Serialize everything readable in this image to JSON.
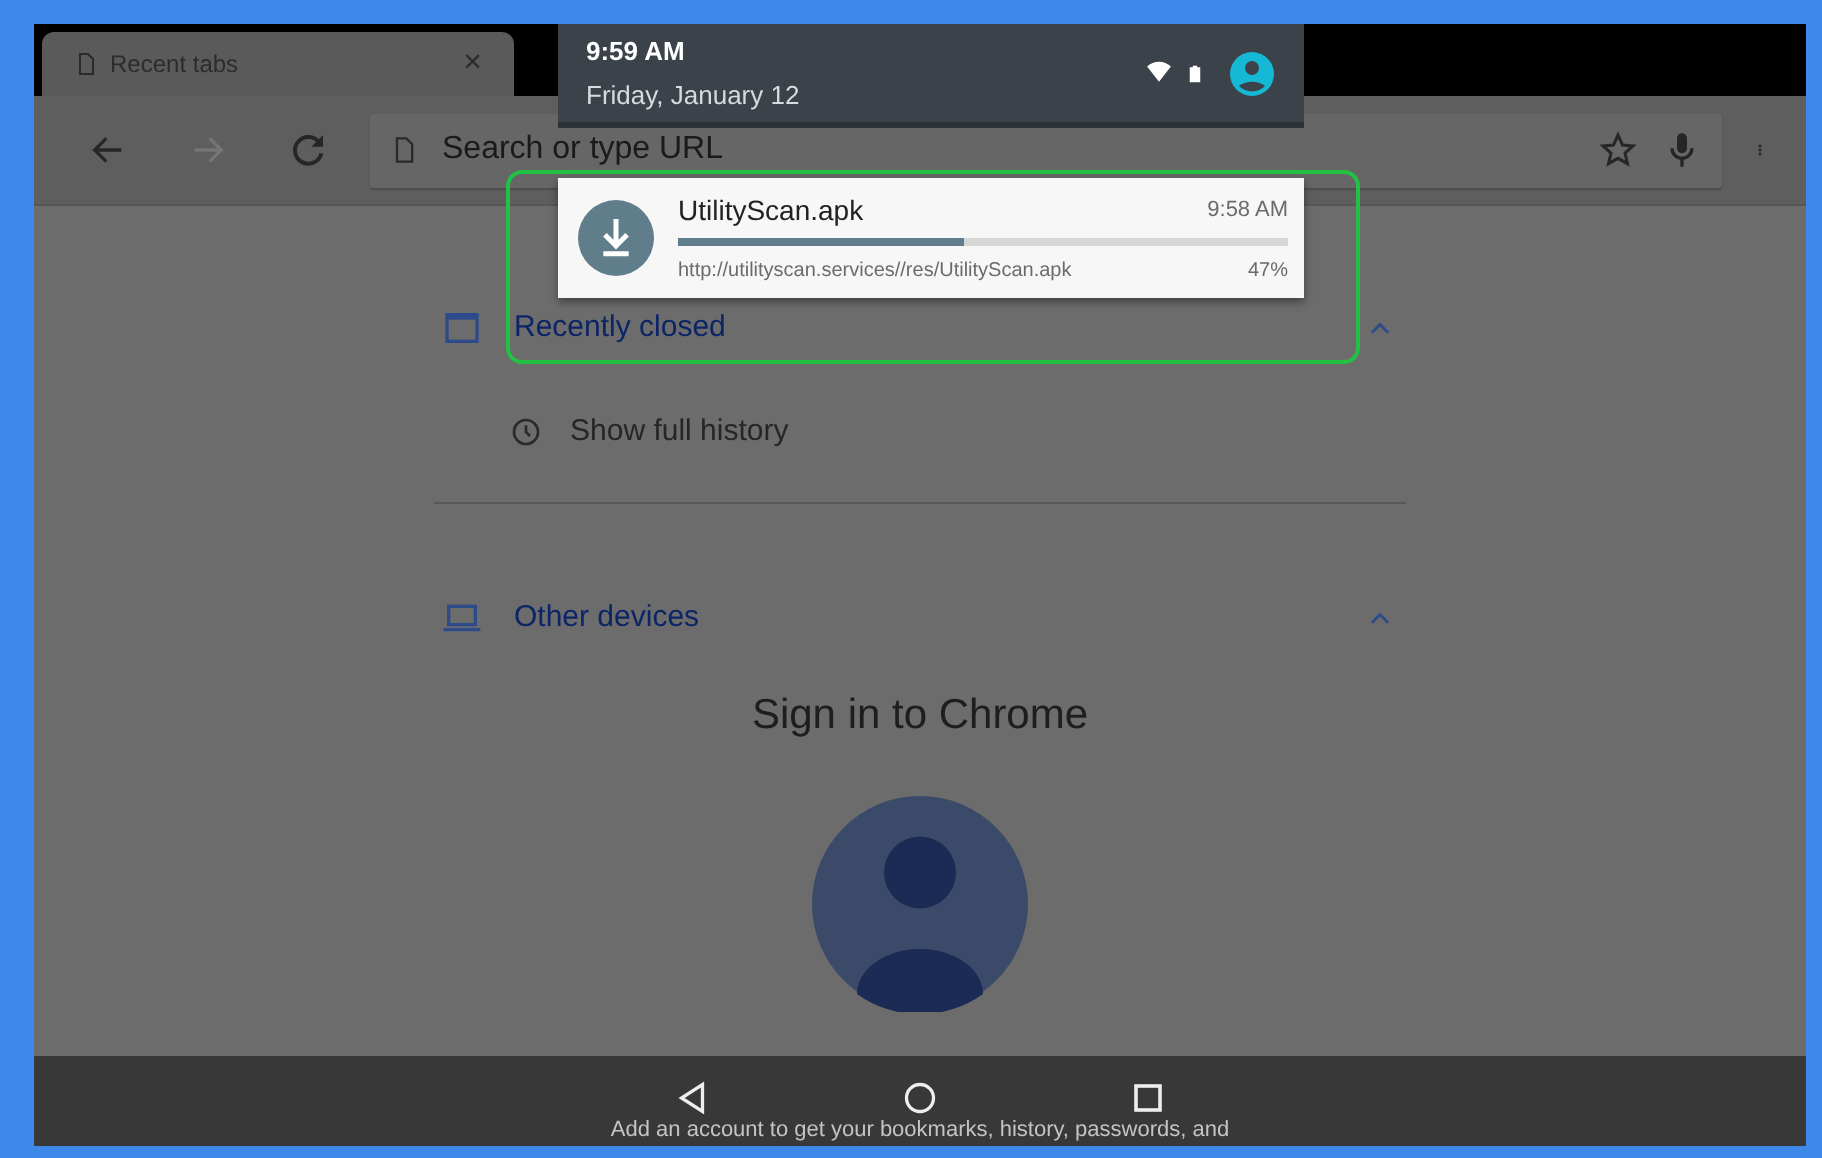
{
  "browser": {
    "tab": {
      "title": "Recent tabs",
      "close": "×"
    },
    "toolbar": [
      {
        "kind": "back",
        "disabled": false
      },
      {
        "kind": "forward",
        "disabled": true
      },
      {
        "kind": "reload",
        "disabled": false
      }
    ],
    "omnibox": {
      "placeholder": "Search or type URL"
    },
    "sections": [
      {
        "kind": "recently_closed",
        "title": "Recently closed",
        "expanded": true,
        "items": [
          "Show full history"
        ]
      },
      {
        "kind": "other_devices",
        "title": "Other devices",
        "expanded": true
      }
    ],
    "sign_in": {
      "title": "Sign in to Chrome",
      "body": "Add an account to get your bookmarks, history, passwords, and"
    }
  },
  "notification_shade": {
    "time": "9:59 AM",
    "date": "Friday, January 12",
    "notification": {
      "title": "UtilityScan.apk",
      "time": "9:58 AM",
      "url": "http://utilityscan.services//res/UtilityScan.apk",
      "percent": "47%",
      "level": 0.47
    }
  }
}
